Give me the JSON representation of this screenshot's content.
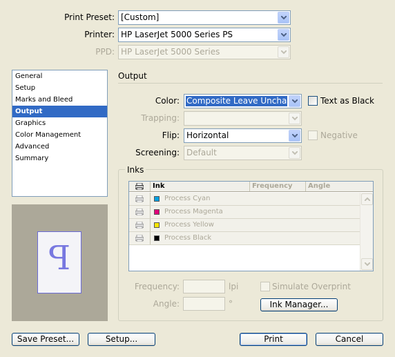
{
  "print_preset": {
    "label": "Print Preset:",
    "value": "[Custom]"
  },
  "printer": {
    "label": "Printer:",
    "value": "HP LaserJet 5000 Series PS"
  },
  "ppd": {
    "label": "PPD:",
    "value": "HP LaserJet 5000 Series"
  },
  "sidebar": {
    "items": [
      {
        "label": "General"
      },
      {
        "label": "Setup"
      },
      {
        "label": "Marks and Bleed"
      },
      {
        "label": "Output"
      },
      {
        "label": "Graphics"
      },
      {
        "label": "Color Management"
      },
      {
        "label": "Advanced"
      },
      {
        "label": "Summary"
      }
    ],
    "selected": "Output"
  },
  "preview": {
    "glyph": "P"
  },
  "output": {
    "section_title": "Output",
    "color": {
      "label": "Color:",
      "value": "Composite Leave Unchanged"
    },
    "text_as_black": {
      "label": "Text as Black",
      "checked": false
    },
    "trapping": {
      "label": "Trapping:",
      "value": ""
    },
    "flip": {
      "label": "Flip:",
      "value": "Horizontal"
    },
    "negative": {
      "label": "Negative",
      "checked": false
    },
    "screening": {
      "label": "Screening:",
      "value": "Default"
    }
  },
  "inks": {
    "title": "Inks",
    "columns": [
      "Ink",
      "Frequency",
      "Angle"
    ],
    "rows": [
      {
        "name": "Process Cyan",
        "color": "#00a0e0"
      },
      {
        "name": "Process Magenta",
        "color": "#e0007a"
      },
      {
        "name": "Process Yellow",
        "color": "#f5e600"
      },
      {
        "name": "Process Black",
        "color": "#000000"
      }
    ],
    "frequency": {
      "label": "Frequency:",
      "unit": "lpi",
      "value": ""
    },
    "angle": {
      "label": "Angle:",
      "unit": "°",
      "value": ""
    },
    "simulate_overprint": {
      "label": "Simulate Overprint",
      "checked": false
    },
    "ink_manager_label": "Ink Manager..."
  },
  "footer": {
    "save_preset_label": "Save Preset...",
    "setup_label": "Setup...",
    "print_label": "Print",
    "cancel_label": "Cancel"
  },
  "colors": {
    "selection": "#316ac5",
    "dialog_bg": "#ece9d8"
  }
}
